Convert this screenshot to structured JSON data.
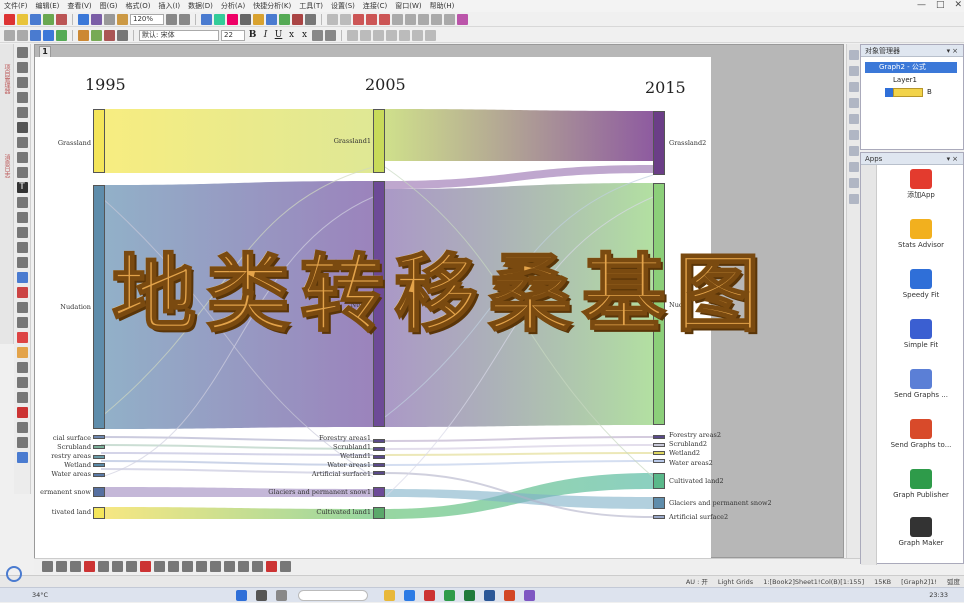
{
  "menubar": {
    "items": [
      "文件(F)",
      "编辑(E)",
      "查看(V)",
      "图(G)",
      "格式(O)",
      "插入(I)",
      "数据(D)",
      "分析(A)",
      "快捷分析(K)",
      "工具(T)",
      "设置(S)",
      "连接(C)",
      "窗口(W)",
      "帮助(H)"
    ]
  },
  "toolbar1": {
    "zoom": "120%"
  },
  "toolbar2": {
    "font_name": "默认: 宋体",
    "font_size": "22"
  },
  "graph_tab": "1",
  "sankey": {
    "years": [
      "1995",
      "2005",
      "2015"
    ],
    "nodes_1995": [
      "Grassland",
      "Nudation",
      "cial surface",
      "Scrubland",
      "restry areas",
      "Wetland",
      "Water areas",
      "ermanent snow",
      "tivated land"
    ],
    "nodes_2005": [
      "Grassland1",
      "Nudat",
      "Forestry areas1",
      "Scrubland1",
      "Wetland1",
      "Water areas1",
      "Artificial surface1",
      "Glaciers and permanent snow1",
      "Cultivated land1"
    ],
    "nodes_2015": [
      "Grassland2",
      "Nudat",
      "Forestry areas2",
      "Scrubland2",
      "Wetland2",
      "Water areas2",
      "Cultivated land2",
      "Glaciers and permanent snow2",
      "Artificial surface2"
    ]
  },
  "overlay_title": "地类转移桑基图",
  "object_manager": {
    "title": "对象管理器",
    "graph": "Graph2 - 公式",
    "layer": "Layer1",
    "plot_tail": "B"
  },
  "apps_panel": {
    "title": "Apps",
    "items": [
      {
        "label": "添加App",
        "icon": "add-app-icon",
        "color": "#e33b2e"
      },
      {
        "label": "Stats Advisor",
        "icon": "wand-icon",
        "color": "#f2b01e"
      },
      {
        "label": "Speedy Fit",
        "icon": "speedy-fit-icon",
        "color": "#2f6fd8"
      },
      {
        "label": "Simple Fit",
        "icon": "simple-fit-icon",
        "color": "#3b5fd1"
      },
      {
        "label": "Send Graphs ...",
        "icon": "send-graphs-icon",
        "color": "#5b7fd6"
      },
      {
        "label": "Send Graphs to...",
        "icon": "send-graphs-ppt-icon",
        "color": "#d84a2a"
      },
      {
        "label": "Graph Publisher",
        "icon": "graph-publisher-icon",
        "color": "#2e9b4a"
      },
      {
        "label": "Graph Maker",
        "icon": "graph-maker-icon",
        "color": "#333333"
      }
    ]
  },
  "statusbar": {
    "au": "AU : 开",
    "grid": "Light Grids",
    "sheet": "1:[Book2]Sheet1!Col(B)[1:155]",
    "size": "15KB",
    "graph": "[Graph2]1!",
    "unit": "弧度"
  },
  "taskbar": {
    "weather": "34°C",
    "time": "23:33"
  },
  "colors": {
    "grassland": "#f4e55a",
    "nudation": "#5f8dab",
    "nudation_2005": "#6d4a97",
    "grassland_2015": "#6b3e87",
    "nudation_2015": "#8ccf7a",
    "title_fill": "#e3a34a"
  }
}
